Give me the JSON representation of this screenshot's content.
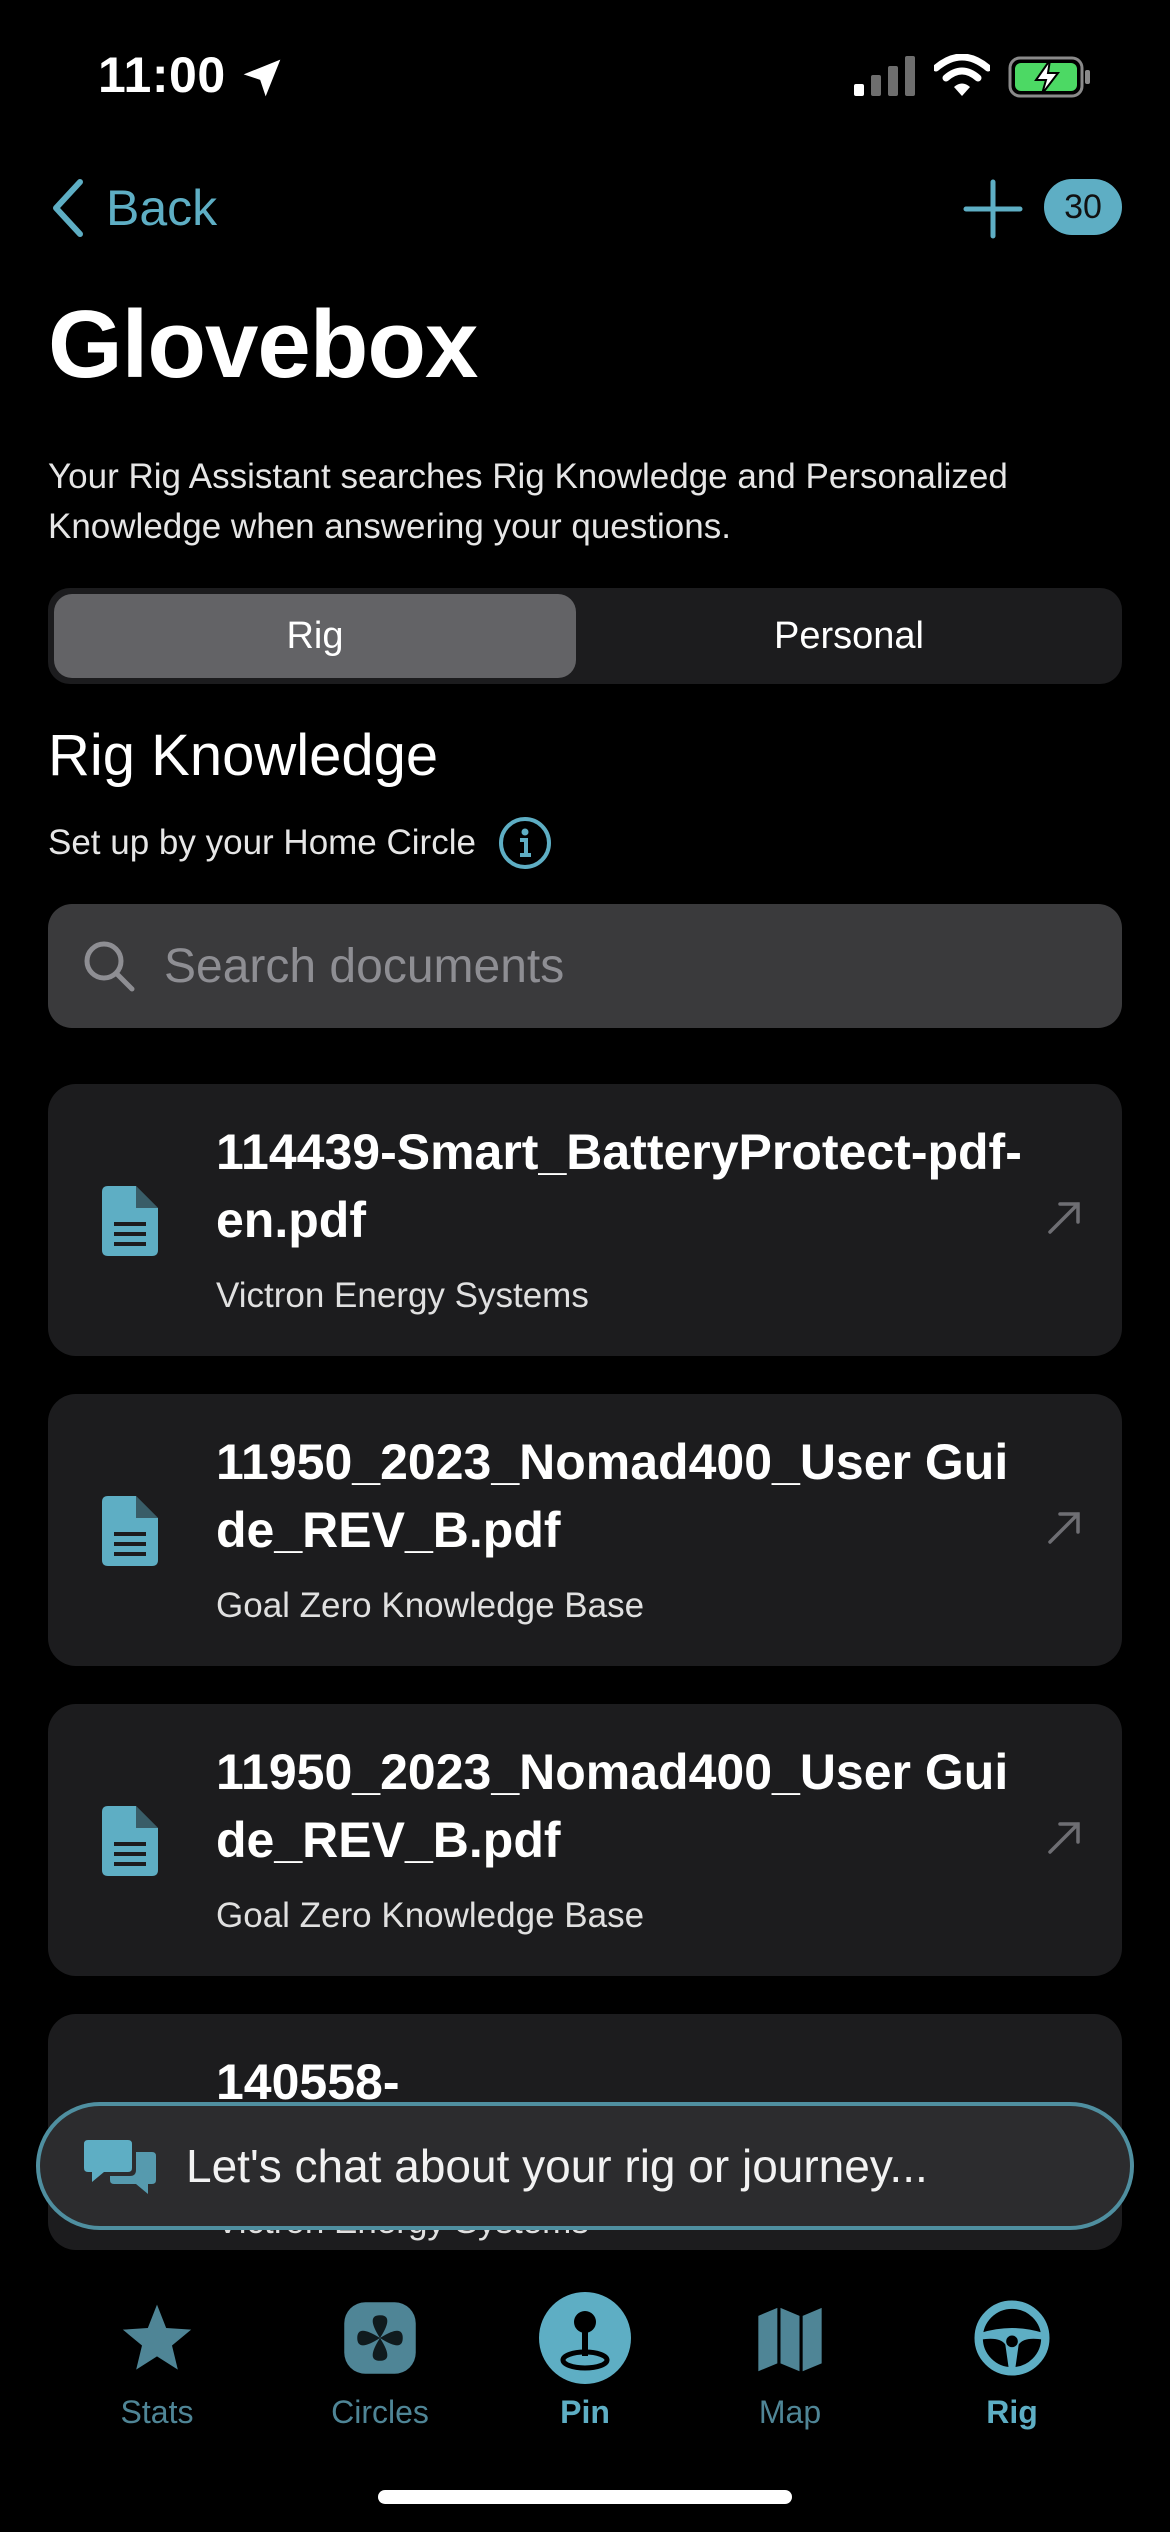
{
  "status_bar": {
    "time": "11:00"
  },
  "nav": {
    "back_label": "Back",
    "badge_count": "30"
  },
  "page": {
    "title": "Glovebox",
    "description": "Your Rig Assistant searches Rig Knowledge and Personalized Knowledge when answering your questions."
  },
  "segments": {
    "rig": "Rig",
    "personal": "Personal"
  },
  "section": {
    "title": "Rig Knowledge",
    "subtitle": "Set up by your Home Circle"
  },
  "search": {
    "placeholder": "Search documents"
  },
  "documents": [
    {
      "title": "114439-Smart_BatteryProtect-pdf-en.pdf",
      "source": "Victron Energy Systems"
    },
    {
      "title": "11950_2023_Nomad400_User Guide_REV_B.pdf",
      "source": "Goal Zero Knowledge Base"
    },
    {
      "title": "11950_2023_Nomad400_User Guide_REV_B.pdf",
      "source": "Goal Zero Knowledge Base"
    },
    {
      "title": "140558-",
      "source": "Victron Energy Systems"
    }
  ],
  "chat": {
    "placeholder": "Let's chat about your rig or journey..."
  },
  "tabs": [
    {
      "label": "Stats",
      "icon": "star-icon"
    },
    {
      "label": "Circles",
      "icon": "propeller-icon"
    },
    {
      "label": "Pin",
      "icon": "joystick-icon"
    },
    {
      "label": "Map",
      "icon": "map-icon"
    },
    {
      "label": "Rig",
      "icon": "steering-wheel-icon"
    }
  ],
  "colors": {
    "accent": "#5eaec4",
    "card_bg": "#1c1c1e",
    "search_bg": "#3a3a3c",
    "active_segment": "#636366"
  }
}
